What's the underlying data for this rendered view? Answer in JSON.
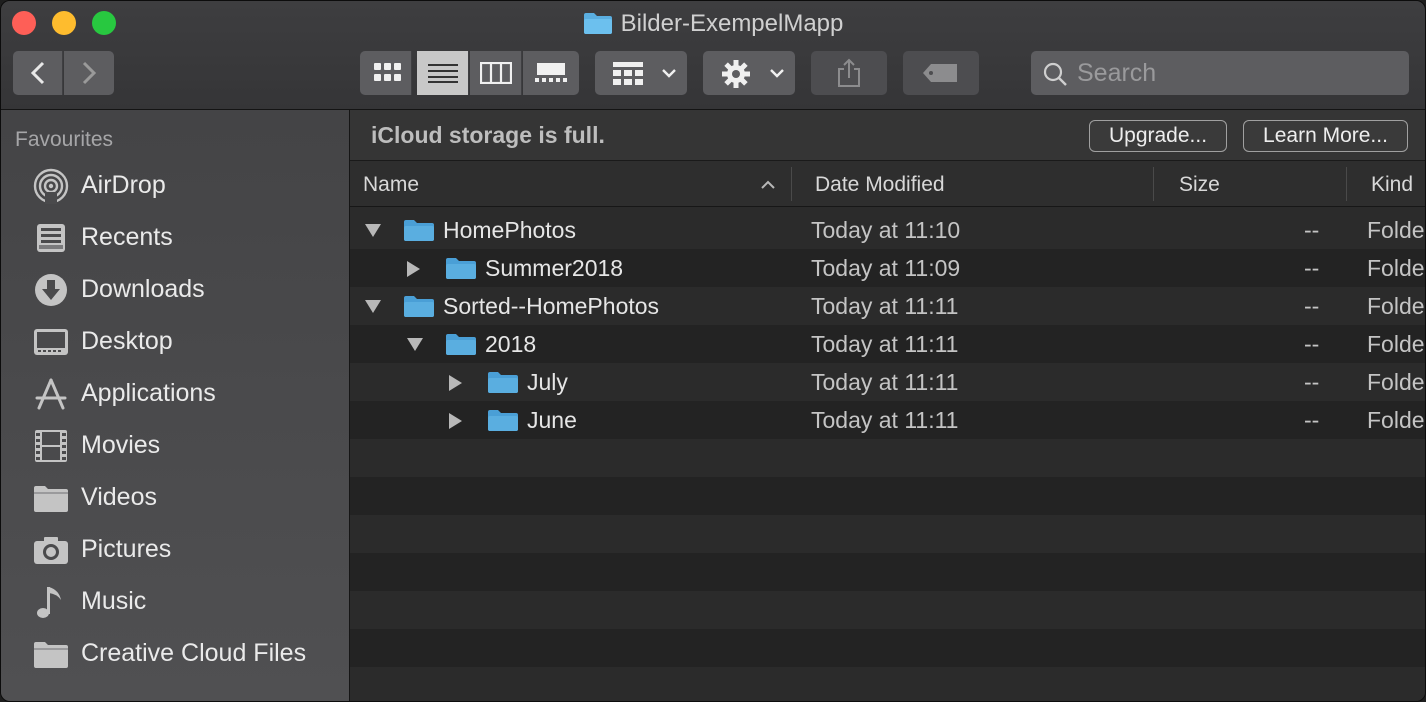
{
  "window": {
    "title": "Bilder-ExempelMapp"
  },
  "toolbar": {
    "view_modes": [
      "icon-view",
      "list-view",
      "column-view",
      "gallery-view"
    ],
    "active_view": "list-view",
    "search_placeholder": "Search"
  },
  "sidebar": {
    "section": "Favourites",
    "items": [
      {
        "label": "AirDrop",
        "icon": "airdrop-icon"
      },
      {
        "label": "Recents",
        "icon": "recents-icon"
      },
      {
        "label": "Downloads",
        "icon": "downloads-icon"
      },
      {
        "label": "Desktop",
        "icon": "desktop-icon"
      },
      {
        "label": "Applications",
        "icon": "applications-icon"
      },
      {
        "label": "Movies",
        "icon": "movies-icon"
      },
      {
        "label": "Videos",
        "icon": "folder-icon"
      },
      {
        "label": "Pictures",
        "icon": "pictures-icon"
      },
      {
        "label": "Music",
        "icon": "music-icon"
      },
      {
        "label": "Creative Cloud Files",
        "icon": "folder-icon"
      }
    ]
  },
  "banner": {
    "text": "iCloud storage is full.",
    "upgrade": "Upgrade...",
    "learn_more": "Learn More..."
  },
  "columns": {
    "name": "Name",
    "date": "Date Modified",
    "size": "Size",
    "kind": "Kind",
    "sort_indicator": "ascending"
  },
  "files": [
    {
      "name": "HomePhotos",
      "date": "Today at 11:10",
      "size": "--",
      "kind": "Folder",
      "level": 0,
      "expanded": true
    },
    {
      "name": "Summer2018",
      "date": "Today at 11:09",
      "size": "--",
      "kind": "Folder",
      "level": 1,
      "expanded": false
    },
    {
      "name": "Sorted--HomePhotos",
      "date": "Today at 11:11",
      "size": "--",
      "kind": "Folder",
      "level": 0,
      "expanded": true
    },
    {
      "name": "2018",
      "date": "Today at 11:11",
      "size": "--",
      "kind": "Folder",
      "level": 1,
      "expanded": true
    },
    {
      "name": "July",
      "date": "Today at 11:11",
      "size": "--",
      "kind": "Folder",
      "level": 2,
      "expanded": false
    },
    {
      "name": "June",
      "date": "Today at 11:11",
      "size": "--",
      "kind": "Folder",
      "level": 2,
      "expanded": false
    }
  ],
  "colors": {
    "folder": "#5aaee0",
    "accent_close": "#fe5f57",
    "accent_min": "#febc2e",
    "accent_max": "#28c840"
  }
}
